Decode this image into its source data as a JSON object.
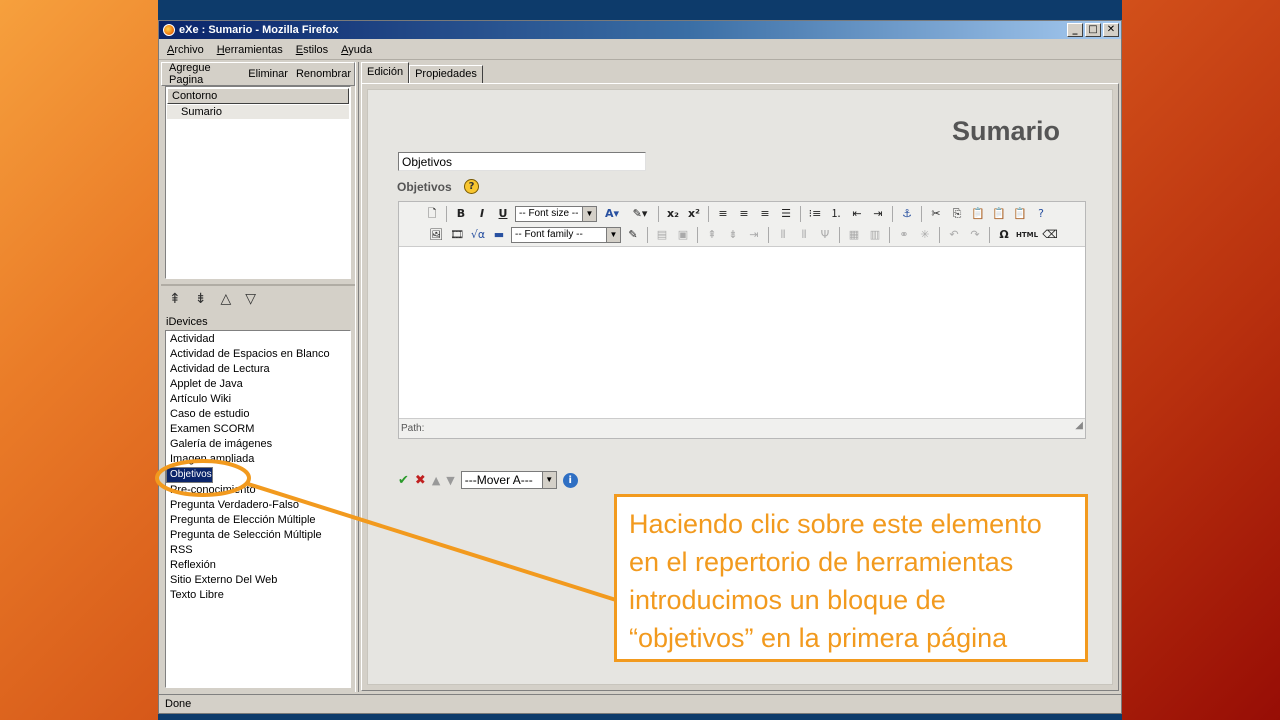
{
  "window": {
    "title": "eXe : Sumario - Mozilla Firefox",
    "controls": [
      "_",
      "□",
      "✕"
    ]
  },
  "menu": [
    "Archivo",
    "Herramientas",
    "Estilos",
    "Ayuda"
  ],
  "outline": {
    "tools": [
      "Agregue Pagina",
      "Eliminar",
      "Renombrar"
    ],
    "header": "Contorno",
    "items": [
      "Sumario"
    ]
  },
  "idevices": {
    "header": "iDevices",
    "items": [
      "Actividad",
      "Actividad de Espacios en Blanco",
      "Actividad de Lectura",
      "Applet de Java",
      "Artículo Wiki",
      "Caso de estudio",
      "Examen SCORM",
      "Galería de imágenes",
      "Imagen ampliada",
      "Objetivos",
      "Pre-conocimiento",
      "Pregunta Verdadero-Falso",
      "Pregunta de Elección Múltiple",
      "Pregunta de Selección Múltiple",
      "RSS",
      "Reflexión",
      "Sitio Externo Del Web",
      "Texto Libre"
    ],
    "selected": "Objetivos"
  },
  "tabs": [
    "Edición",
    "Propiedades"
  ],
  "page": {
    "title": "Sumario",
    "title_field_value": "Objetivos",
    "field_label": "Objetivos"
  },
  "editor": {
    "font_size_label": "-- Font size --",
    "font_family_label": "-- Font family --",
    "path_label": "Path:",
    "html_label": "HTML"
  },
  "actions": {
    "move_label": "---Mover A---"
  },
  "status": "Done",
  "callout": {
    "lines": [
      "Haciendo clic sobre este elemento",
      "en el repertorio de herramientas",
      "introducimos un bloque de",
      "“objetivos” en la primera página"
    ],
    "color": "#f29a1e"
  }
}
